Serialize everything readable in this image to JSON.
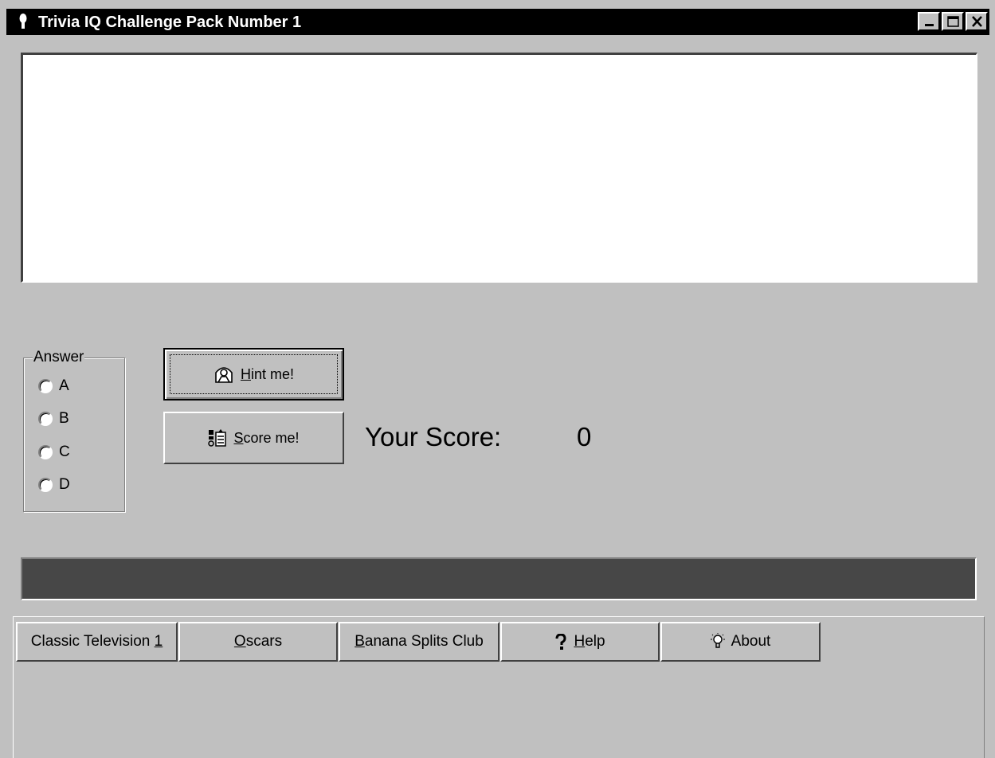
{
  "window": {
    "title": "Trivia IQ Challenge Pack Number 1",
    "controls": {
      "minimize": "minimize",
      "maximize": "maximize",
      "close": "close"
    }
  },
  "question": {
    "text": ""
  },
  "answer_group": {
    "legend": "Answer",
    "options": [
      "A",
      "B",
      "C",
      "D"
    ],
    "selected": null
  },
  "buttons": {
    "hint": {
      "pre": "",
      "mnemonic": "H",
      "post": "int me!",
      "icon": "hint-icon"
    },
    "score": {
      "pre": "",
      "mnemonic": "S",
      "post": "core me!",
      "icon": "score-icon"
    }
  },
  "score": {
    "label": "Your Score:",
    "value": "0"
  },
  "progress": {
    "value": 0
  },
  "tabs": [
    {
      "pre": "Classic Television ",
      "mnemonic": "1",
      "post": ""
    },
    {
      "pre": "",
      "mnemonic": "O",
      "post": "scars"
    },
    {
      "pre": "",
      "mnemonic": "B",
      "post": "anana Splits Club"
    },
    {
      "pre": "",
      "mnemonic": "H",
      "post": "elp",
      "icon": "question-mark-icon"
    },
    {
      "pre": "About",
      "mnemonic": "",
      "post": "",
      "icon": "lightbulb-icon"
    }
  ]
}
